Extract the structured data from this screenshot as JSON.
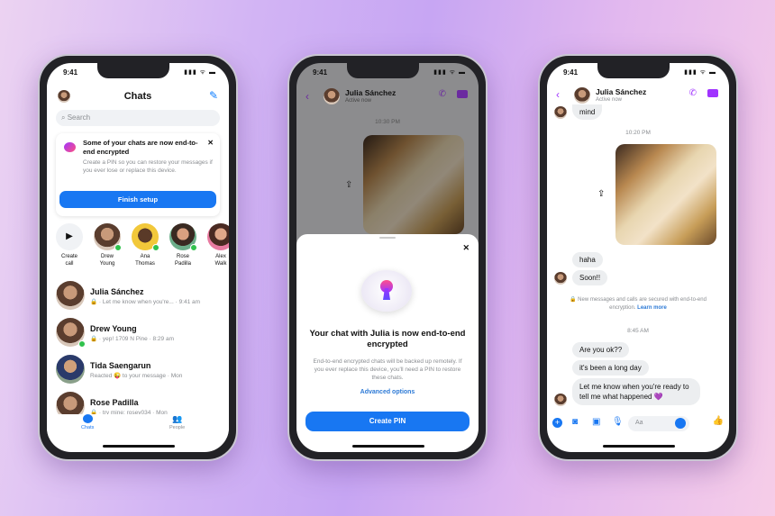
{
  "status_bar": {
    "time": "9:41",
    "signal": "▮▮▮ ᯤ ▬"
  },
  "phone1": {
    "title": "Chats",
    "search_placeholder": "Search",
    "banner": {
      "title": "Some of your chats are now end-to-end encrypted",
      "body": "Create a PIN so you can restore your messages if you ever lose or replace this device.",
      "button": "Finish setup",
      "close": "✕"
    },
    "stories": [
      {
        "label": "Create call"
      },
      {
        "label": "Drew Young"
      },
      {
        "label": "Ana Thomas"
      },
      {
        "label": "Rose Padilla"
      },
      {
        "label": "Alex Walk"
      }
    ],
    "chats": [
      {
        "name": "Julia Sánchez",
        "preview": "🔒 · Let me know when you're... · 9:41 am",
        "online": false
      },
      {
        "name": "Drew Young",
        "preview": "🔒 · yep! 1709 N Pine · 8:29 am",
        "online": true
      },
      {
        "name": "Tida Saengarun",
        "preview": "Reacted 😜 to your message · Mon",
        "online": false
      },
      {
        "name": "Rose Padilla",
        "preview": "🔒 · try mine: rosey034 · Mon",
        "online": false
      }
    ],
    "tabs": [
      {
        "label": "Chats",
        "active": true
      },
      {
        "label": "People",
        "active": false
      }
    ]
  },
  "phone2": {
    "contact": "Julia Sánchez",
    "status": "Active now",
    "timestamp": "10:30 PM",
    "sheet": {
      "title": "Your chat with Julia is now end-to-end encrypted",
      "body": "End-to-end encrypted chats will be backed up remotely. If you ever replace this device, you'll need a PIN to restore these chats.",
      "link": "Advanced options",
      "button": "Create PIN",
      "close": "✕"
    }
  },
  "phone3": {
    "contact": "Julia Sánchez",
    "status": "Active now",
    "messages_top": [
      {
        "text": "mind"
      }
    ],
    "timestamp1": "10:20 PM",
    "messages_mid": [
      {
        "text": "haha"
      },
      {
        "text": "Soon!!"
      }
    ],
    "notice": "🔒 New messages and calls are secured with end-to-end encryption.",
    "notice_link": "Learn more",
    "timestamp2": "8:45 AM",
    "messages_bottom": [
      {
        "text": "Are you ok??"
      },
      {
        "text": "it's been a long day"
      },
      {
        "text": "Let me know when you're ready to tell me what happened 💜"
      }
    ],
    "composer_placeholder": "Aa"
  },
  "colors": {
    "accent": "#1877f2",
    "messenger_purple": "#a033ff",
    "online": "#31c24d"
  }
}
